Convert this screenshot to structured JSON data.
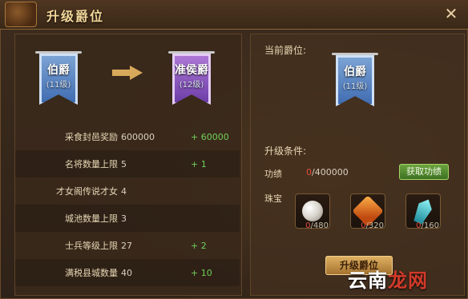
{
  "window": {
    "title": "升级爵位"
  },
  "icons": {
    "close": "close-icon",
    "arrow": "arrow-right-icon",
    "emblem": "game-emblem-icon"
  },
  "current_rank": {
    "name": "伯爵",
    "level": "(11级)"
  },
  "next_rank": {
    "name": "准侯爵",
    "level": "(12级)"
  },
  "stats": [
    {
      "label": "采食封邑奖励",
      "value": "600000",
      "bonus": "+ 60000"
    },
    {
      "label": "名将数量上限",
      "value": "5",
      "bonus": "+ 1"
    },
    {
      "label": "才女阁传说才女",
      "value": "4",
      "bonus": ""
    },
    {
      "label": "城池数量上限",
      "value": "3",
      "bonus": ""
    },
    {
      "label": "士兵等级上限",
      "value": "27",
      "bonus": "+ 2"
    },
    {
      "label": "满税县城数量",
      "value": "40",
      "bonus": "+ 10"
    }
  ],
  "right": {
    "current_label": "当前爵位:",
    "current_rank": {
      "name": "伯爵",
      "level": "(11级)"
    },
    "conditions_label": "升级条件:",
    "merit": {
      "label": "功绩",
      "current": "0",
      "required": "/400000",
      "button": "获取功绩"
    },
    "jewels": {
      "label": "珠宝",
      "items": [
        {
          "name": "pearl-icon",
          "current": "0",
          "required": "/480"
        },
        {
          "name": "amber-icon",
          "current": "0",
          "required": "/320"
        },
        {
          "name": "crystal-icon",
          "current": "0",
          "required": "/160"
        }
      ]
    },
    "upgrade_button": "升级爵位"
  },
  "watermark": {
    "part1": "云南",
    "part2": "龙网"
  },
  "colors": {
    "bonus_green": "#6fd05a",
    "deficit_red": "#e24c3a",
    "title_gold": "#f3d79a"
  }
}
